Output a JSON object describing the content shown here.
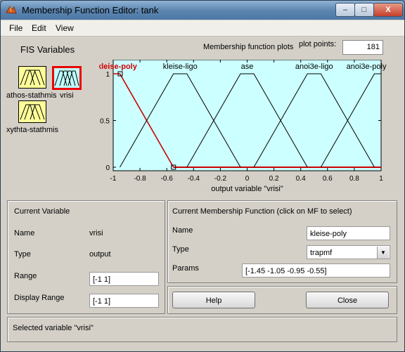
{
  "window": {
    "title": "Membership Function Editor: tank",
    "controls": {
      "minimize": "–",
      "maximize": "□",
      "close": "X"
    }
  },
  "menu": {
    "items": [
      "File",
      "Edit",
      "View"
    ]
  },
  "fis_panel": {
    "title": "FIS Variables",
    "variables": [
      {
        "label": "athos-stathmis",
        "selected": false
      },
      {
        "label": "vrisi",
        "selected": true
      },
      {
        "label": "xythta-stathmis",
        "selected": false
      }
    ]
  },
  "plot": {
    "title": "Membership function plots",
    "plot_points_label": "plot points:",
    "plot_points_value": "181",
    "xlabel": "output variable \"vrisi\"",
    "background": "#ccffff",
    "selected_color": "#cc0000",
    "x_ticks": [
      "-1",
      "-0.8",
      "-0.6",
      "-0.4",
      "-0.2",
      "0",
      "0.2",
      "0.4",
      "0.6",
      "0.8",
      "1"
    ],
    "y_ticks": [
      "0",
      "0.5",
      "1"
    ]
  },
  "chart_data": {
    "type": "line",
    "xlabel": "output variable \"vrisi\"",
    "ylabel": "",
    "xlim": [
      -1,
      1
    ],
    "ylim": [
      0,
      1
    ],
    "series": [
      {
        "name": "kleise-poly",
        "params": [
          -1.45,
          -1.05,
          -0.95,
          -0.55
        ],
        "selected": true
      },
      {
        "name": "kleise-ligo",
        "params": [
          -0.95,
          -0.55,
          -0.45,
          -0.05
        ],
        "selected": false
      },
      {
        "name": "ase",
        "params": [
          -0.45,
          -0.05,
          0.05,
          0.45
        ],
        "selected": false
      },
      {
        "name": "anoi3e-ligo",
        "params": [
          0.05,
          0.45,
          0.55,
          0.95
        ],
        "selected": false
      },
      {
        "name": "anoi3e-poly",
        "params": [
          0.55,
          0.95,
          1.05,
          1.45
        ],
        "selected": false
      }
    ]
  },
  "current_variable": {
    "title": "Current Variable",
    "name_label": "Name",
    "name_value": "vrisi",
    "type_label": "Type",
    "type_value": "output",
    "range_label": "Range",
    "range_value": "[-1 1]",
    "display_range_label": "Display Range",
    "display_range_value": "[-1 1]"
  },
  "current_mf": {
    "title": "Current Membership Function (click on MF to select)",
    "name_label": "Name",
    "name_value": "kleise-poly",
    "type_label": "Type",
    "type_value": "trapmf",
    "params_label": "Params",
    "params_value": "[-1.45 -1.05 -0.95 -0.55]"
  },
  "buttons": {
    "help": "Help",
    "close": "Close"
  },
  "status": {
    "text": "Selected variable \"vrisi\""
  }
}
